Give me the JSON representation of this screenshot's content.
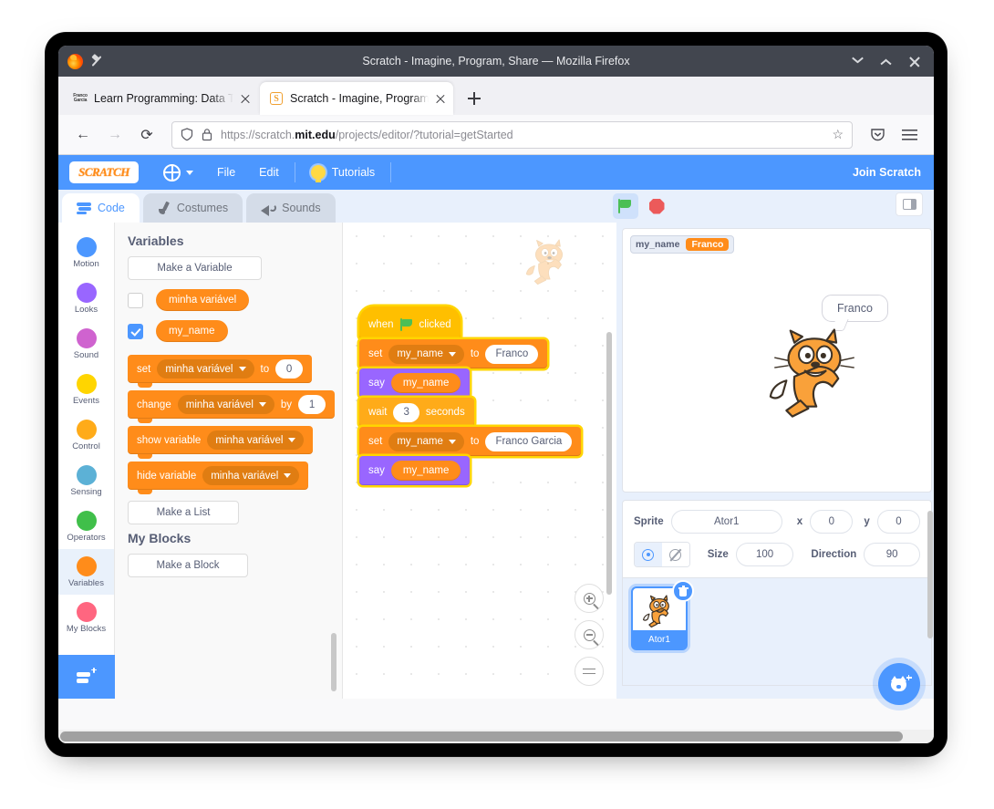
{
  "window": {
    "title": "Scratch - Imagine, Program, Share — Mozilla Firefox",
    "minimize_label": "Minimize",
    "maximize_label": "Maximize",
    "close_label": "Close"
  },
  "browser": {
    "tabs": [
      {
        "favicon": "franco-garcia-text-icon",
        "favicon_text": "Franco Garcia",
        "title": "Learn Programming: Data Typ",
        "active": false
      },
      {
        "favicon": "scratch-favicon",
        "favicon_text": "S",
        "title": "Scratch - Imagine, Program, S",
        "active": true
      }
    ],
    "new_tab_label": "+",
    "nav": {
      "back": "←",
      "forward": "→",
      "reload": "⟳",
      "url_display": "https://scratch.mit.edu/projects/editor/?tutorial=getStarted",
      "url_scheme": "https://scratch.",
      "url_domain": "mit.edu",
      "url_path": "/projects/editor/?tutorial=getStarted",
      "shield_icon": "shield-icon",
      "lock_icon": "lock-icon",
      "bookmark_icon": "star-icon",
      "pocket_icon": "pocket-icon",
      "menu_icon": "hamburger-menu-icon"
    }
  },
  "scratch_menu": {
    "logo": "SCRATCH",
    "language_icon": "globe-icon",
    "items": [
      "File",
      "Edit"
    ],
    "tutorials": "Tutorials",
    "tutorials_icon": "lightbulb-icon",
    "join": "Join Scratch"
  },
  "editor_tabs": [
    {
      "label": "Code",
      "icon": "code-blocks-icon",
      "active": true
    },
    {
      "label": "Costumes",
      "icon": "paintbrush-icon",
      "active": false
    },
    {
      "label": "Sounds",
      "icon": "speaker-icon",
      "active": false
    }
  ],
  "stage_controls": {
    "green_flag": "green-flag-icon",
    "stop": "stop-sign-icon",
    "layout": "small-stage-layout-icon"
  },
  "categories": [
    {
      "label": "Motion",
      "color": "#4c97ff",
      "selected": false
    },
    {
      "label": "Looks",
      "color": "#9966ff",
      "selected": false
    },
    {
      "label": "Sound",
      "color": "#cf63cf",
      "selected": false
    },
    {
      "label": "Events",
      "color": "#ffd500",
      "selected": false
    },
    {
      "label": "Control",
      "color": "#ffab19",
      "selected": false
    },
    {
      "label": "Sensing",
      "color": "#5cb1d6",
      "selected": false
    },
    {
      "label": "Operators",
      "color": "#40bf4a",
      "selected": false
    },
    {
      "label": "Variables",
      "color": "#ff8c1a",
      "selected": true
    },
    {
      "label": "My Blocks",
      "color": "#ff6680",
      "selected": false
    }
  ],
  "extension_button": "add-extension-icon",
  "palette": {
    "heading": "Variables",
    "make_variable": "Make a Variable",
    "variables": [
      {
        "name": "minha variável",
        "checked": false
      },
      {
        "name": "my_name",
        "checked": true
      }
    ],
    "blocks": [
      {
        "op": "set",
        "var": "minha variável",
        "mid": "to",
        "value": "0"
      },
      {
        "op": "change",
        "var": "minha variável",
        "mid": "by",
        "value": "1"
      },
      {
        "op": "show variable",
        "var": "minha variável"
      },
      {
        "op": "hide variable",
        "var": "minha variável"
      }
    ],
    "make_list": "Make a List",
    "my_blocks_heading": "My Blocks",
    "make_block": "Make a Block"
  },
  "script": {
    "hat": {
      "pre": "when",
      "flag": "green-flag-icon",
      "post": "clicked"
    },
    "blocks": [
      {
        "type": "set",
        "op": "set",
        "var": "my_name",
        "mid": "to",
        "value": "Franco"
      },
      {
        "type": "say",
        "op": "say",
        "var": "my_name"
      },
      {
        "type": "wait",
        "op": "wait",
        "value": "3",
        "post": "seconds"
      },
      {
        "type": "set",
        "op": "set",
        "var": "my_name",
        "mid": "to",
        "value": "Franco Garcia"
      },
      {
        "type": "say",
        "op": "say",
        "var": "my_name"
      }
    ]
  },
  "workspace": {
    "zoom_in": "zoom-in-icon",
    "zoom_out": "zoom-out-icon",
    "zoom_reset": "zoom-reset-icon",
    "watermark": "sprite-watermark-cat"
  },
  "stage": {
    "monitor": {
      "label": "my_name",
      "value": "Franco"
    },
    "speech_bubble": "Franco",
    "sprite_image": "scratch-cat"
  },
  "sprite_info": {
    "sprite_label": "Sprite",
    "sprite_name": "Ator1",
    "x_label": "x",
    "x_value": "0",
    "y_label": "y",
    "y_value": "0",
    "show_icon": "eye-visible-icon",
    "hide_icon": "eye-hidden-icon",
    "size_label": "Size",
    "size_value": "100",
    "direction_label": "Direction",
    "direction_value": "90"
  },
  "sprite_list": {
    "sprites": [
      {
        "name": "Ator1",
        "selected": true,
        "delete_icon": "trash-icon"
      }
    ],
    "add_sprite": "add-sprite-icon"
  }
}
